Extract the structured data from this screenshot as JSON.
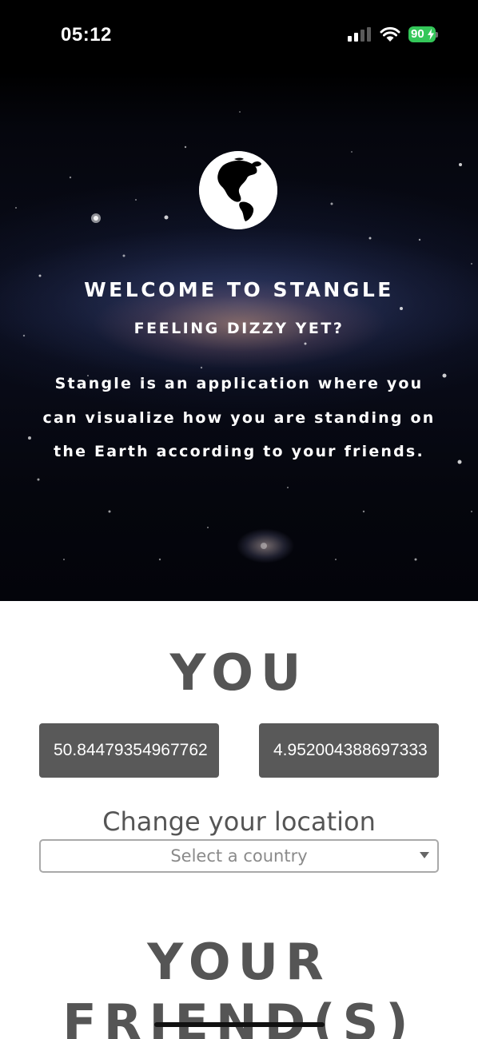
{
  "status_bar": {
    "time": "05:12",
    "battery": "90",
    "icons": [
      "cellular-signal-icon",
      "wifi-icon",
      "battery-charging-icon"
    ]
  },
  "hero": {
    "logo_icon": "globe-icon",
    "title": "WELCOME TO STANGLE",
    "subtitle": "FEELING DIZZY YET?",
    "description": "Stangle is an application where you can visualize how you are standing on the Earth according to your friends."
  },
  "you_section": {
    "title": "YOU",
    "latitude": "50.84479354967762",
    "longitude": "4.952004388697333",
    "change_location_label": "Change your location",
    "country_select": {
      "placeholder": "Select a country"
    }
  },
  "friends_section": {
    "title_line1": "YOUR",
    "title_line2": "FRIEND(S)"
  },
  "colors": {
    "accent_text": "#555555",
    "input_bg": "#595959",
    "battery_green": "#34c759",
    "hero_bg": "#05060d"
  }
}
